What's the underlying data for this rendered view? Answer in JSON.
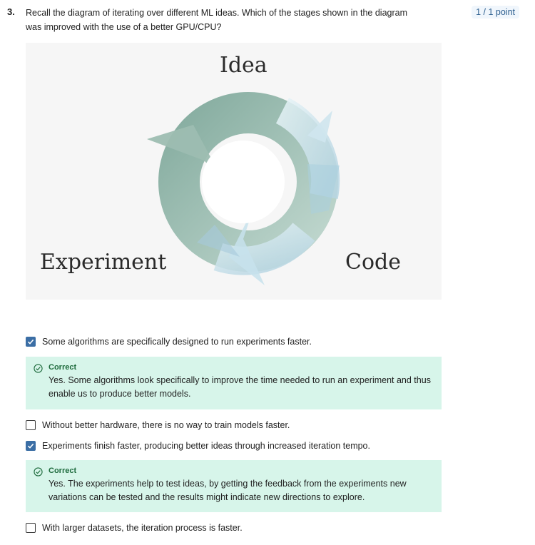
{
  "question": {
    "number": "3.",
    "text": "Recall the diagram of iterating over different ML ideas. Which of the stages shown in the diagram was improved with the use of a better GPU/CPU?",
    "points": "1 / 1 point"
  },
  "figure": {
    "labels": {
      "idea": "Idea",
      "experiment": "Experiment",
      "code": "Code"
    },
    "colors": {
      "ring_dark": "#8fb3a5",
      "ring_light": "#d3e8f0",
      "background": "#f6f6f6"
    }
  },
  "options": [
    {
      "label": "Some algorithms are specifically designed to run experiments faster.",
      "checked": true,
      "feedback": {
        "title": "Correct",
        "text": "Yes. Some algorithms look specifically to improve the time needed to run an experiment and thus enable us to produce better models."
      }
    },
    {
      "label": "Without better hardware, there is no way to train models faster.",
      "checked": false
    },
    {
      "label": "Experiments finish faster, producing better ideas through increased iteration tempo.",
      "checked": true,
      "feedback": {
        "title": "Correct",
        "text": "Yes. The experiments help to test ideas, by getting the feedback from the experiments new variations can be tested and the results might indicate new directions to explore."
      }
    },
    {
      "label": "With larger datasets, the iteration process is faster.",
      "checked": false
    }
  ],
  "colors": {
    "feedback_bg": "#d7f5ea",
    "correct_text": "#1e6b3d",
    "checkbox_checked": "#3b6ea5",
    "badge_bg": "#f0f6fc"
  }
}
